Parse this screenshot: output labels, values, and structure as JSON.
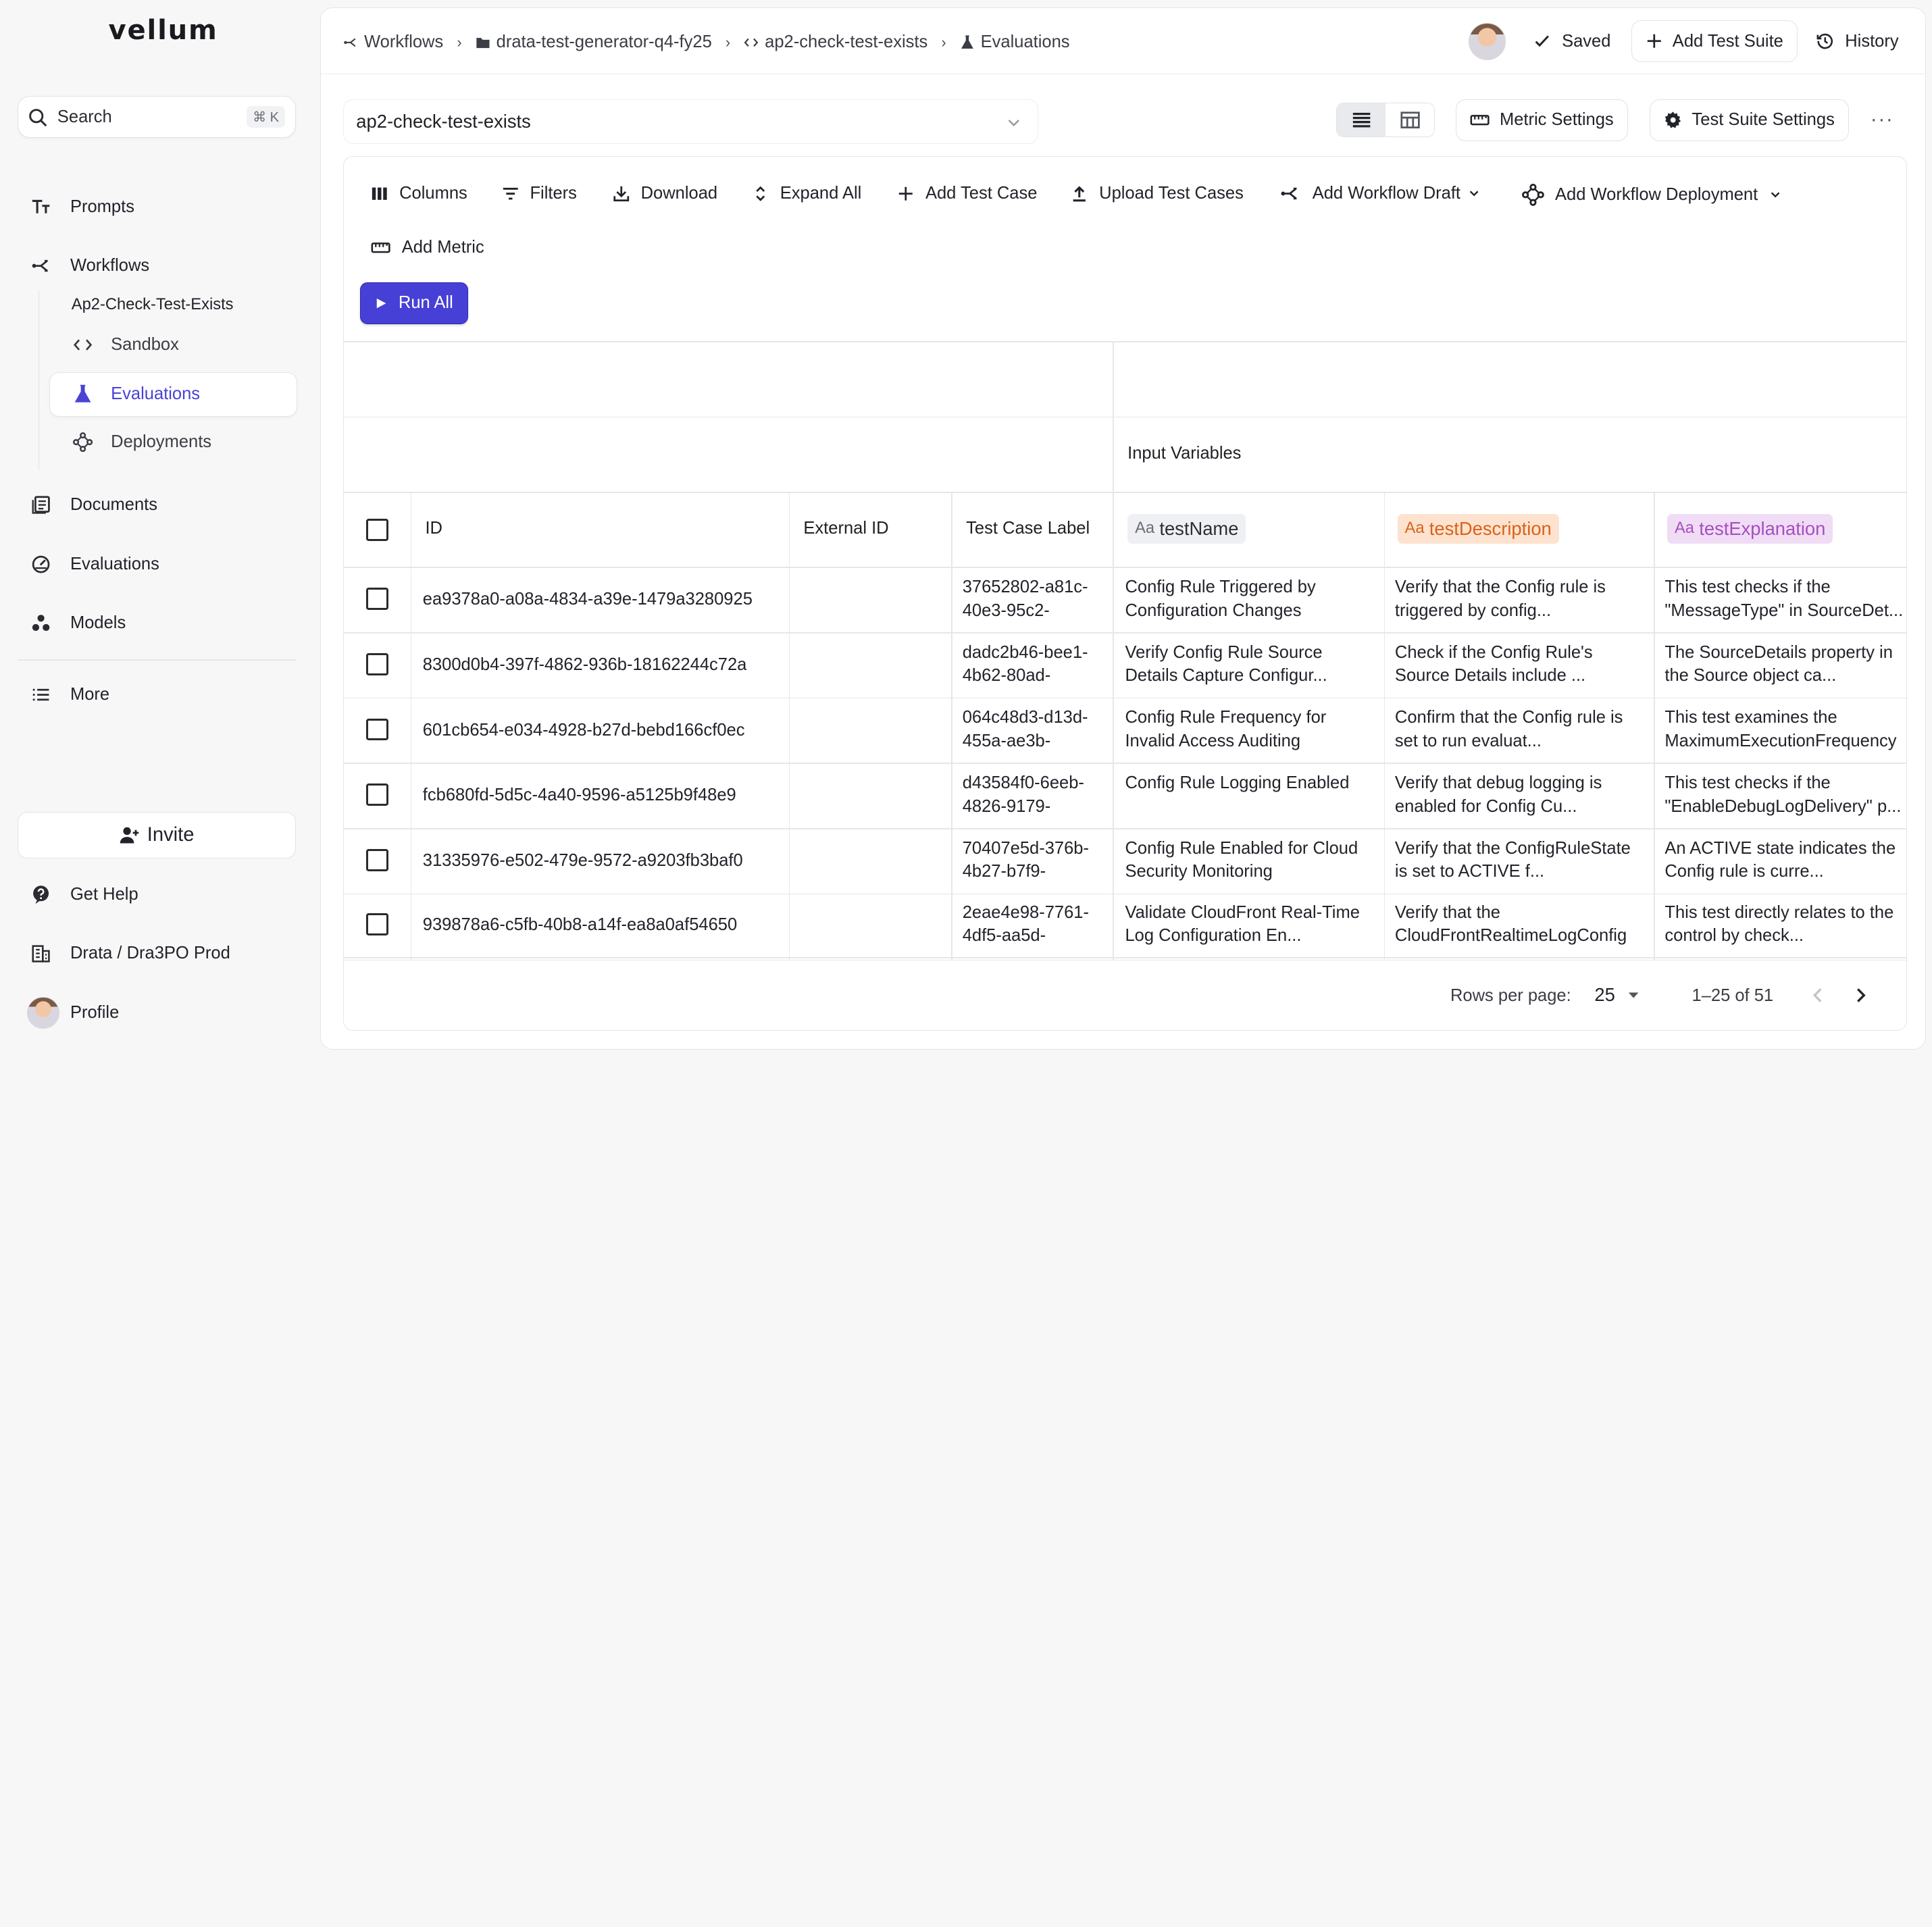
{
  "sidebar": {
    "logo": "vellum",
    "search": {
      "label": "Search",
      "shortcut": "⌘ K"
    },
    "nav": {
      "prompts": "Prompts",
      "workflows": "Workflows",
      "workflow_name": "Ap2-Check-Test-Exists",
      "sandbox": "Sandbox",
      "evaluations_sub": "Evaluations",
      "deployments": "Deployments",
      "documents": "Documents",
      "evaluations": "Evaluations",
      "models": "Models",
      "more": "More"
    },
    "invite": "Invite",
    "get_help": "Get Help",
    "org": "Drata / Dra3PO Prod",
    "profile": "Profile"
  },
  "header": {
    "breadcrumbs": [
      "Workflows",
      "drata-test-generator-q4-fy25",
      "ap2-check-test-exists",
      "Evaluations"
    ],
    "saved": "Saved",
    "add_test_suite": "Add Test Suite",
    "history": "History"
  },
  "suite_select": {
    "value": "ap2-check-test-exists"
  },
  "metric_settings": "Metric Settings",
  "test_suite_settings": "Test Suite Settings",
  "more_menu": "···",
  "toolbar": {
    "columns": "Columns",
    "filters": "Filters",
    "download": "Download",
    "expand_all": "Expand All",
    "add_test_case": "Add Test Case",
    "upload_test_cases": "Upload Test Cases",
    "add_workflow_draft": "Add Workflow Draft",
    "add_workflow_deployment": "Add Workflow Deployment",
    "add_metric": "Add Metric",
    "run_all": "Run All"
  },
  "table": {
    "group_header": "Input Variables",
    "headers": {
      "id": "ID",
      "external_id": "External ID",
      "label": "Test Case Label",
      "var1": "testName",
      "var2": "testDescription",
      "var3": "testExplanation",
      "var_prefix": "Aa"
    },
    "colors": {
      "var2": "#d9621a",
      "var3": "#a54fc0",
      "run_all": "#4740d6"
    },
    "rows": [
      {
        "id": "ea9378a0-a08a-4834-a39e-1479a3280925",
        "external_id": "",
        "label": "37652802-a81c-40e3-95c2-",
        "testName": "Config Rule Triggered by Configuration Changes",
        "testDescription": "Verify that the Config rule is triggered by config...",
        "testExplanation": "This test checks if the \"MessageType\" in SourceDet..."
      },
      {
        "id": "8300d0b4-397f-4862-936b-18162244c72a",
        "external_id": "",
        "label": "dadc2b46-bee1-4b62-80ad-",
        "testName": "Verify Config Rule Source Details Capture Configur...",
        "testDescription": "Check if the Config Rule's Source Details include ...",
        "testExplanation": "The SourceDetails property in the Source object ca..."
      },
      {
        "id": "601cb654-e034-4928-b27d-bebd166cf0ec",
        "external_id": "",
        "label": "064c48d3-d13d-455a-ae3b-",
        "testName": "Config Rule Frequency for Invalid Access Auditing",
        "testDescription": "Confirm that the Config rule is set to run evaluat...",
        "testExplanation": "This test examines the MaximumExecutionFrequency"
      },
      {
        "id": "fcb680fd-5d5c-4a40-9596-a5125b9f48e9",
        "external_id": "",
        "label": "d43584f0-6eeb-4826-9179-",
        "testName": "Config Rule Logging Enabled",
        "testDescription": "Verify that debug logging is enabled for Config Cu...",
        "testExplanation": "This test checks if the \"EnableDebugLogDelivery\" p..."
      },
      {
        "id": "31335976-e502-479e-9572-a9203fb3baf0",
        "external_id": "",
        "label": "70407e5d-376b-4b27-b7f9-",
        "testName": "Config Rule Enabled for Cloud Security Monitoring",
        "testDescription": "Verify that the ConfigRuleState is set to ACTIVE f...",
        "testExplanation": "An ACTIVE state indicates the Config rule is curre..."
      },
      {
        "id": "939878a6-c5fb-40b8-a14f-ea8a0af54650",
        "external_id": "",
        "label": "2eae4e98-7761-4df5-aa5d-",
        "testName": "Validate CloudFront Real-Time Log Configuration En...",
        "testDescription": "Verify that the CloudFrontRealtimeLogConfig",
        "testExplanation": "This test directly relates to the control by check..."
      }
    ]
  },
  "pagination": {
    "rows_per_page_label": "Rows per page:",
    "rows_per_page": "25",
    "range": "1–25 of 51"
  }
}
